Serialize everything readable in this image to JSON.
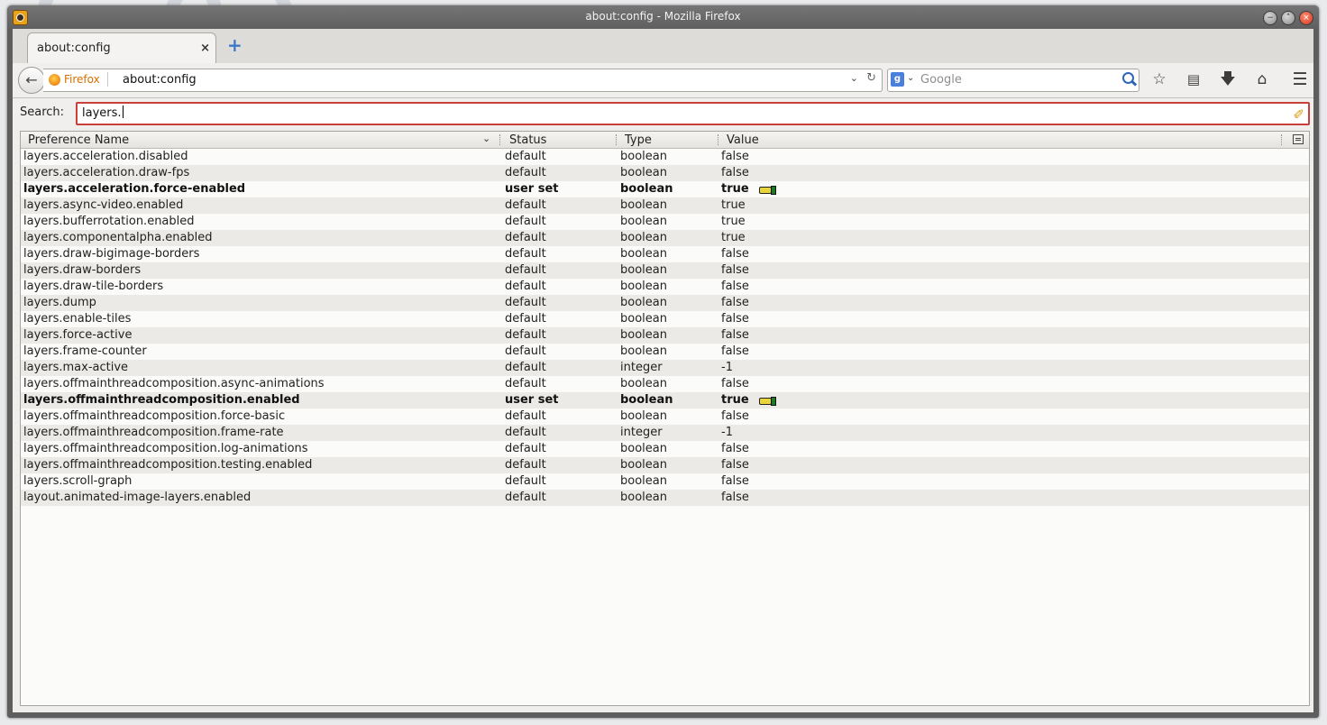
{
  "window": {
    "title": "about:config - Mozilla Firefox"
  },
  "tabs": [
    {
      "label": "about:config"
    }
  ],
  "navbar": {
    "identity": "Firefox",
    "url": "about:config",
    "search_placeholder": "Google"
  },
  "filter": {
    "label": "Search:",
    "value": "layers."
  },
  "columns": {
    "name": "Preference Name",
    "status": "Status",
    "type": "Type",
    "value": "Value"
  },
  "prefs": [
    {
      "name": "layers.acceleration.disabled",
      "status": "default",
      "type": "boolean",
      "value": "false"
    },
    {
      "name": "layers.acceleration.draw-fps",
      "status": "default",
      "type": "boolean",
      "value": "false"
    },
    {
      "name": "layers.acceleration.force-enabled",
      "status": "user set",
      "type": "boolean",
      "value": "true"
    },
    {
      "name": "layers.async-video.enabled",
      "status": "default",
      "type": "boolean",
      "value": "true"
    },
    {
      "name": "layers.bufferrotation.enabled",
      "status": "default",
      "type": "boolean",
      "value": "true"
    },
    {
      "name": "layers.componentalpha.enabled",
      "status": "default",
      "type": "boolean",
      "value": "true"
    },
    {
      "name": "layers.draw-bigimage-borders",
      "status": "default",
      "type": "boolean",
      "value": "false"
    },
    {
      "name": "layers.draw-borders",
      "status": "default",
      "type": "boolean",
      "value": "false"
    },
    {
      "name": "layers.draw-tile-borders",
      "status": "default",
      "type": "boolean",
      "value": "false"
    },
    {
      "name": "layers.dump",
      "status": "default",
      "type": "boolean",
      "value": "false"
    },
    {
      "name": "layers.enable-tiles",
      "status": "default",
      "type": "boolean",
      "value": "false"
    },
    {
      "name": "layers.force-active",
      "status": "default",
      "type": "boolean",
      "value": "false"
    },
    {
      "name": "layers.frame-counter",
      "status": "default",
      "type": "boolean",
      "value": "false"
    },
    {
      "name": "layers.max-active",
      "status": "default",
      "type": "integer",
      "value": "-1"
    },
    {
      "name": "layers.offmainthreadcomposition.async-animations",
      "status": "default",
      "type": "boolean",
      "value": "false"
    },
    {
      "name": "layers.offmainthreadcomposition.enabled",
      "status": "user set",
      "type": "boolean",
      "value": "true"
    },
    {
      "name": "layers.offmainthreadcomposition.force-basic",
      "status": "default",
      "type": "boolean",
      "value": "false"
    },
    {
      "name": "layers.offmainthreadcomposition.frame-rate",
      "status": "default",
      "type": "integer",
      "value": "-1"
    },
    {
      "name": "layers.offmainthreadcomposition.log-animations",
      "status": "default",
      "type": "boolean",
      "value": "false"
    },
    {
      "name": "layers.offmainthreadcomposition.testing.enabled",
      "status": "default",
      "type": "boolean",
      "value": "false"
    },
    {
      "name": "layers.scroll-graph",
      "status": "default",
      "type": "boolean",
      "value": "false"
    },
    {
      "name": "layout.animated-image-layers.enabled",
      "status": "default",
      "type": "boolean",
      "value": "false"
    }
  ],
  "icons": {
    "back": "back-arrow-icon",
    "bookmark": "star-icon",
    "reading_list": "clipboard-icon",
    "downloads": "download-arrow-icon",
    "home": "home-icon",
    "menu": "hamburger-menu-icon",
    "clear": "broom-icon",
    "user_set": "modified-pref-icon"
  },
  "colors": {
    "search_border": "#c93f3a",
    "identity": "#d76e00"
  }
}
